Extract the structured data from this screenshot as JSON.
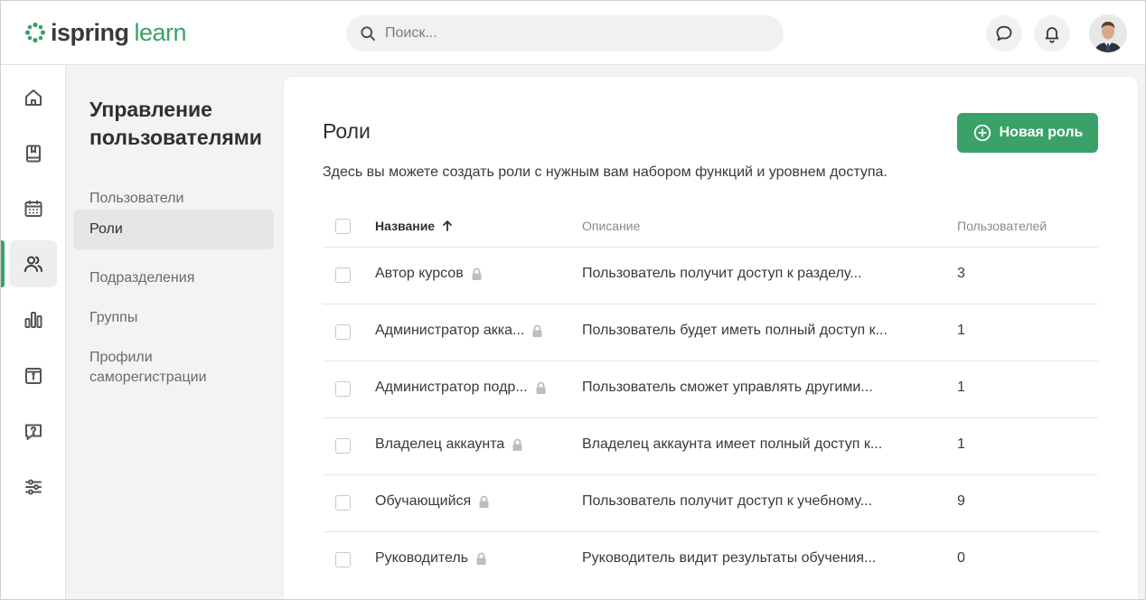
{
  "header": {
    "logo_part1": "ispring",
    "logo_part2": "learn",
    "search_placeholder": "Поиск...",
    "icons": [
      "chat-icon",
      "bell-icon"
    ],
    "brand_color": "#3aa168"
  },
  "rail": {
    "items": [
      {
        "icon": "home-icon"
      },
      {
        "icon": "book-icon"
      },
      {
        "icon": "calendar-icon"
      },
      {
        "icon": "users-icon",
        "active": true
      },
      {
        "icon": "chart-icon"
      },
      {
        "icon": "info-icon"
      },
      {
        "icon": "question-icon"
      },
      {
        "icon": "sliders-icon"
      }
    ]
  },
  "subnav": {
    "title": "Управление пользователями",
    "items": [
      {
        "label": "Пользователи"
      },
      {
        "label": "Роли",
        "active": true
      },
      {
        "label": "Подразделения"
      },
      {
        "label": "Группы"
      },
      {
        "label": "Профили саморегистрации"
      }
    ]
  },
  "main": {
    "title": "Роли",
    "new_button": "Новая роль",
    "description": "Здесь вы можете создать роли с нужным вам набором функций и уровнем доступа.",
    "table": {
      "columns": [
        "Название",
        "Описание",
        "Пользователей"
      ],
      "sort": "ascending",
      "rows": [
        {
          "name": "Автор курсов",
          "desc": "Пользователь получит доступ к разделу...",
          "count": "3",
          "locked": true
        },
        {
          "name": "Администратор акка...",
          "desc": "Пользователь будет иметь полный доступ к...",
          "count": "1",
          "locked": true
        },
        {
          "name": "Администратор подр...",
          "desc": "Пользователь сможет управлять другими...",
          "count": "1",
          "locked": true
        },
        {
          "name": "Владелец аккаунта",
          "desc": "Владелец аккаунта имеет полный доступ к...",
          "count": "1",
          "locked": true
        },
        {
          "name": "Обучающийся",
          "desc": "Пользователь получит доступ к учебному...",
          "count": "9",
          "locked": true
        },
        {
          "name": "Руководитель",
          "desc": "Руководитель видит результаты обучения...",
          "count": "0",
          "locked": true
        }
      ]
    }
  }
}
